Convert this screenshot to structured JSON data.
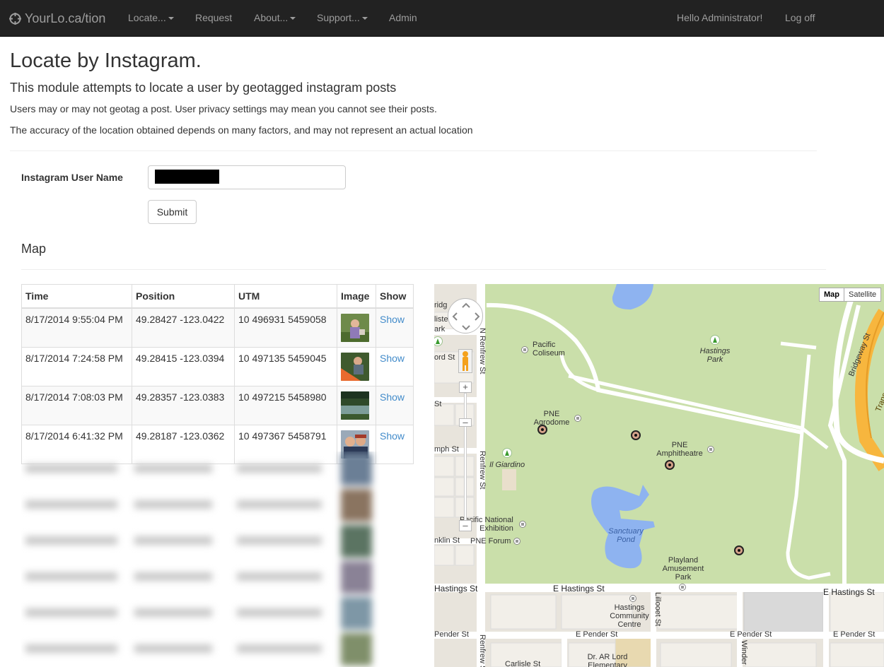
{
  "navbar": {
    "brand": "YourLo.ca/tion",
    "items": [
      {
        "label": "Locate...",
        "dropdown": true
      },
      {
        "label": "Request",
        "dropdown": false
      },
      {
        "label": "About...",
        "dropdown": true
      },
      {
        "label": "Support...",
        "dropdown": true
      },
      {
        "label": "Admin",
        "dropdown": false
      }
    ],
    "greeting": "Hello Administrator!",
    "logoff": "Log off"
  },
  "page": {
    "title": "Locate by Instagram.",
    "subtitle": "This module attempts to locate a user by geotagged instagram posts",
    "note1": "Users may or may not geotag a post. User privacy settings may mean you cannot see their posts.",
    "note2": "The accuracy of the location obtained depends on many factors, and may not represent an actual location"
  },
  "form": {
    "username_label": "Instagram User Name",
    "username_value": "",
    "submit_label": "Submit"
  },
  "map_section": {
    "title": "Map"
  },
  "table": {
    "headers": [
      "Time",
      "Position",
      "UTM",
      "Image",
      "Show"
    ],
    "rows": [
      {
        "time": "8/17/2014 9:55:04 PM",
        "position": "49.28427 -123.0422",
        "utm": "10 496931 5459058",
        "show": "Show"
      },
      {
        "time": "8/17/2014 7:24:58 PM",
        "position": "49.28415 -123.0394",
        "utm": "10 497135 5459045",
        "show": "Show"
      },
      {
        "time": "8/17/2014 7:08:03 PM",
        "position": "49.28357 -123.0383",
        "utm": "10 497215 5458980",
        "show": "Show"
      },
      {
        "time": "8/17/2014 6:41:32 PM",
        "position": "49.28187 -123.0362",
        "utm": "10 497367 5458791",
        "show": "Show"
      }
    ]
  },
  "map": {
    "type_buttons": [
      "Map",
      "Satellite"
    ],
    "labels": {
      "pacific_coliseum": "Pacific\nColiseum",
      "hastings_park": "Hastings\nPark",
      "pne_agrodome": "PNE\nAgrodome",
      "pne_amphitheatre": "PNE\nAmphitheatre",
      "il_giardino": "Il Giardino",
      "sanctuary_pond": "Sanctuary\nPond",
      "playland": "Playland\nAmusement\nPark",
      "pacific_national_exhibition": "Pacific National\nExhibition",
      "pne_forum": "PNE Forum",
      "hastings_community_centre": "Hastings\nCommunity\nCentre",
      "dr_ar_lord": "Dr. AR Lord\nElementary",
      "n_renfrew_st": "N Renfrew St",
      "renfrew_st": "Renfrew St",
      "renfrew_st_2": "Renfrew St",
      "bridgeway_st": "Bridgeway St",
      "trans_canada": "Trans-Canada",
      "e_hastings_st": "E Hastings St",
      "e_hastings_st_2": "E Hastings St",
      "hastings_st_left": "Hastings St",
      "e_pender_st": "E Pender St",
      "e_pender_st_2": "E Pender St",
      "e_pender_st_3": "E Pender St",
      "pender_st_left": "Pender St",
      "lillooet_st": "Lillooet St",
      "windermere": "Winder",
      "carlisle_st": "Carlisle St",
      "frag_ridge": "ridg",
      "frag_liste": "liste",
      "frag_park": "ark",
      "frag_ord_st": "ord St",
      "frag_st": "St",
      "frag_mph_st": "mph St",
      "frag_nklin_st": "nklin St"
    }
  }
}
